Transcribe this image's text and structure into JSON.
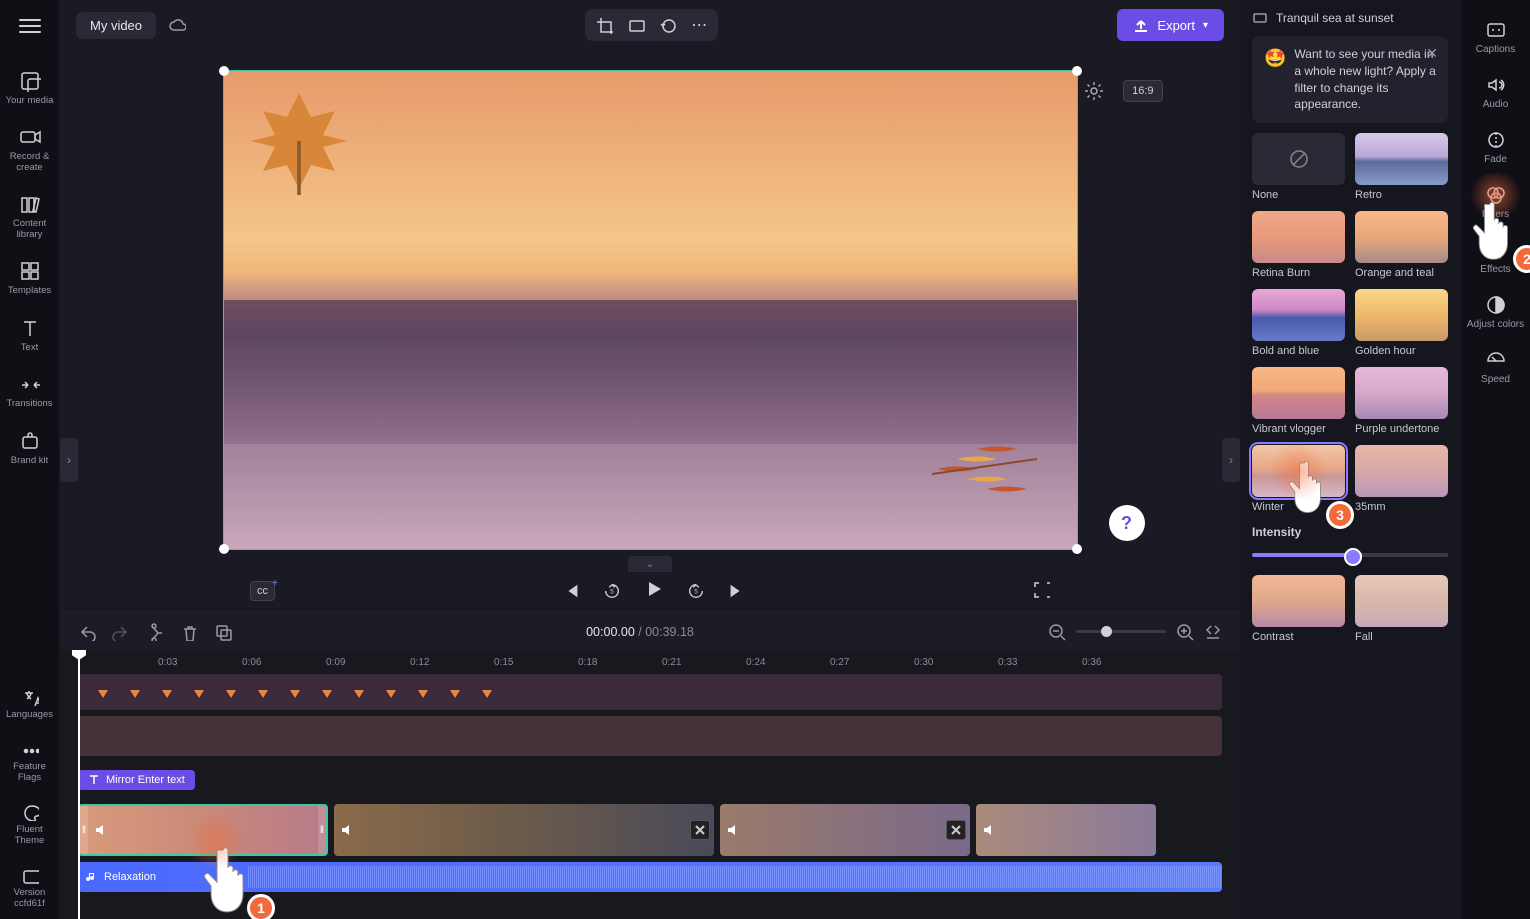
{
  "header": {
    "title": "My video",
    "export_label": "Export",
    "aspect_ratio": "16:9"
  },
  "left_sidebar": [
    {
      "key": "your-media",
      "label": "Your media"
    },
    {
      "key": "record-create",
      "label": "Record & create"
    },
    {
      "key": "content-library",
      "label": "Content library"
    },
    {
      "key": "templates",
      "label": "Templates"
    },
    {
      "key": "text",
      "label": "Text"
    },
    {
      "key": "transitions",
      "label": "Transitions"
    },
    {
      "key": "brand-kit",
      "label": "Brand kit"
    }
  ],
  "left_sidebar_bottom": [
    {
      "key": "languages",
      "label": "Languages"
    },
    {
      "key": "feature-flags",
      "label": "Feature Flags"
    },
    {
      "key": "fluent-theme",
      "label": "Fluent Theme"
    },
    {
      "key": "version",
      "label": "Version ccfd61f"
    }
  ],
  "player": {
    "current_time": "00:00.00",
    "total_time": "00:39.18"
  },
  "ruler_ticks": [
    "0:03",
    "0:06",
    "0:09",
    "0:12",
    "0:15",
    "0:18",
    "0:21",
    "0:24",
    "0:27",
    "0:30",
    "0:33",
    "0:36"
  ],
  "timeline": {
    "text_clip_label": "Mirror Enter text",
    "audio_clip_label": "Relaxation"
  },
  "right_panel": {
    "media_name": "Tranquil sea at sunset",
    "tip_text": "Want to see your media in a whole new light? Apply a filter to change its appearance.",
    "filters": [
      {
        "id": "none",
        "label": "None"
      },
      {
        "id": "retro",
        "label": "Retro"
      },
      {
        "id": "retina",
        "label": "Retina Burn"
      },
      {
        "id": "orange",
        "label": "Orange and teal"
      },
      {
        "id": "bold",
        "label": "Bold and blue"
      },
      {
        "id": "golden",
        "label": "Golden hour"
      },
      {
        "id": "vibrant",
        "label": "Vibrant vlogger"
      },
      {
        "id": "purple",
        "label": "Purple undertone"
      },
      {
        "id": "winter",
        "label": "Winter"
      },
      {
        "id": "35mm",
        "label": "35mm"
      },
      {
        "id": "contrast",
        "label": "Contrast"
      },
      {
        "id": "fall",
        "label": "Fall"
      }
    ],
    "intensity_label": "Intensity"
  },
  "right_sidebar": [
    {
      "key": "captions",
      "label": "Captions"
    },
    {
      "key": "audio",
      "label": "Audio"
    },
    {
      "key": "fade",
      "label": "Fade"
    },
    {
      "key": "filters",
      "label": "Filters"
    },
    {
      "key": "effects",
      "label": "Effects"
    },
    {
      "key": "adjust-colors",
      "label": "Adjust colors"
    },
    {
      "key": "speed",
      "label": "Speed"
    }
  ],
  "annotations": {
    "cursor1_badge": "1",
    "cursor2_badge": "2",
    "cursor3_badge": "3"
  }
}
